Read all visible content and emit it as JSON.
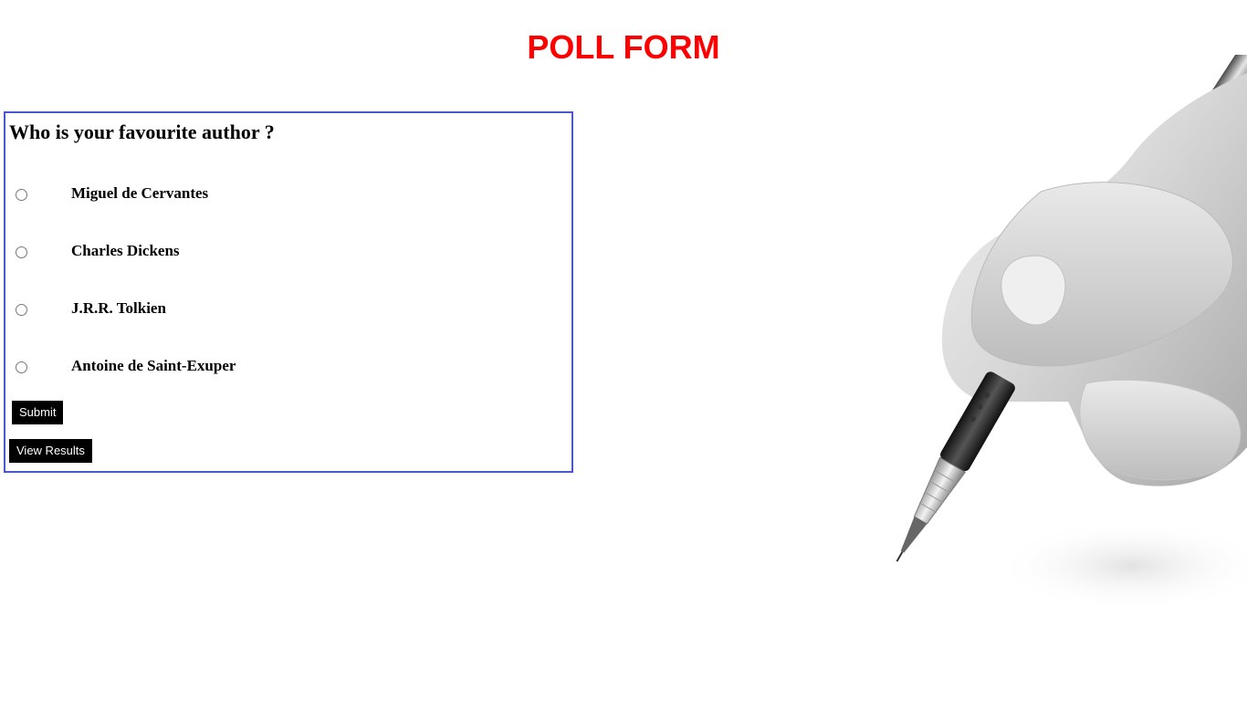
{
  "page": {
    "title": "POLL FORM"
  },
  "poll": {
    "question": "Who is your favourite author ?",
    "options": [
      {
        "label": "Miguel de Cervantes",
        "selected": false
      },
      {
        "label": "Charles Dickens",
        "selected": false
      },
      {
        "label": "J.R.R. Tolkien",
        "selected": false
      },
      {
        "label": "Antoine de Saint-Exuper",
        "selected": false
      }
    ],
    "submit_label": "Submit",
    "view_results_label": "View Results"
  },
  "colors": {
    "title": "#ff0000",
    "border": "#4a55d0",
    "button_bg": "#000000",
    "button_text": "#ffffff"
  },
  "illustration": {
    "icon": "hand-holding-pen-icon"
  }
}
